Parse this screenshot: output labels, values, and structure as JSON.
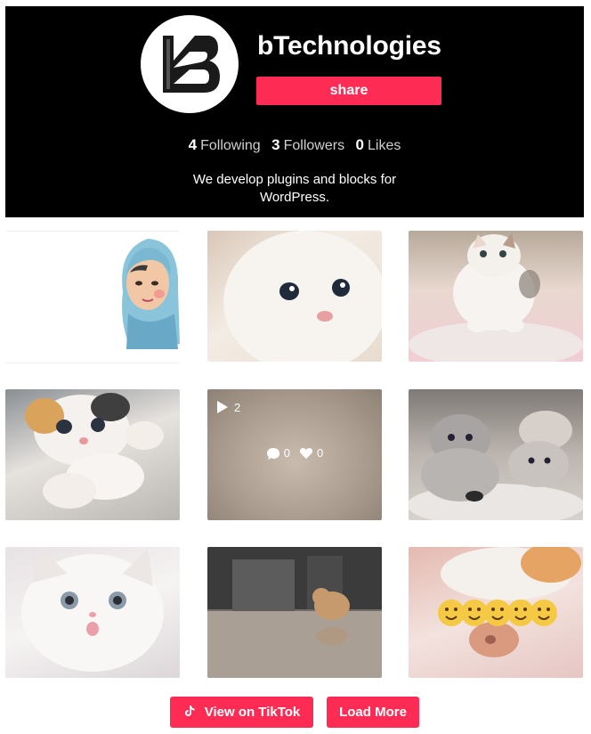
{
  "profile": {
    "username": "bTechnologies",
    "share_label": "share",
    "following_count": "4",
    "following_label": "Following",
    "followers_count": "3",
    "followers_label": "Followers",
    "likes_count": "0",
    "likes_label": "Likes",
    "bio": "We develop plugins and blocks for WordPress."
  },
  "videos": [
    {
      "thumb": "hijab-girl-illustration"
    },
    {
      "thumb": "white-kitten-closeup"
    },
    {
      "thumb": "kitten-on-pink-blanket"
    },
    {
      "thumb": "calico-kitten-paws"
    },
    {
      "thumb": "blurred-video",
      "play_count": "2",
      "comments": "0",
      "likes": "0"
    },
    {
      "thumb": "grey-kittens-group"
    },
    {
      "thumb": "fluffy-white-kitten"
    },
    {
      "thumb": "kitten-on-tiled-floor"
    },
    {
      "thumb": "kitten-with-smiley-emojis"
    }
  ],
  "actions": {
    "view_on_tiktok": "View on TikTok",
    "load_more": "Load More"
  },
  "colors": {
    "accent": "#fe2c55",
    "header_bg": "#000000"
  }
}
